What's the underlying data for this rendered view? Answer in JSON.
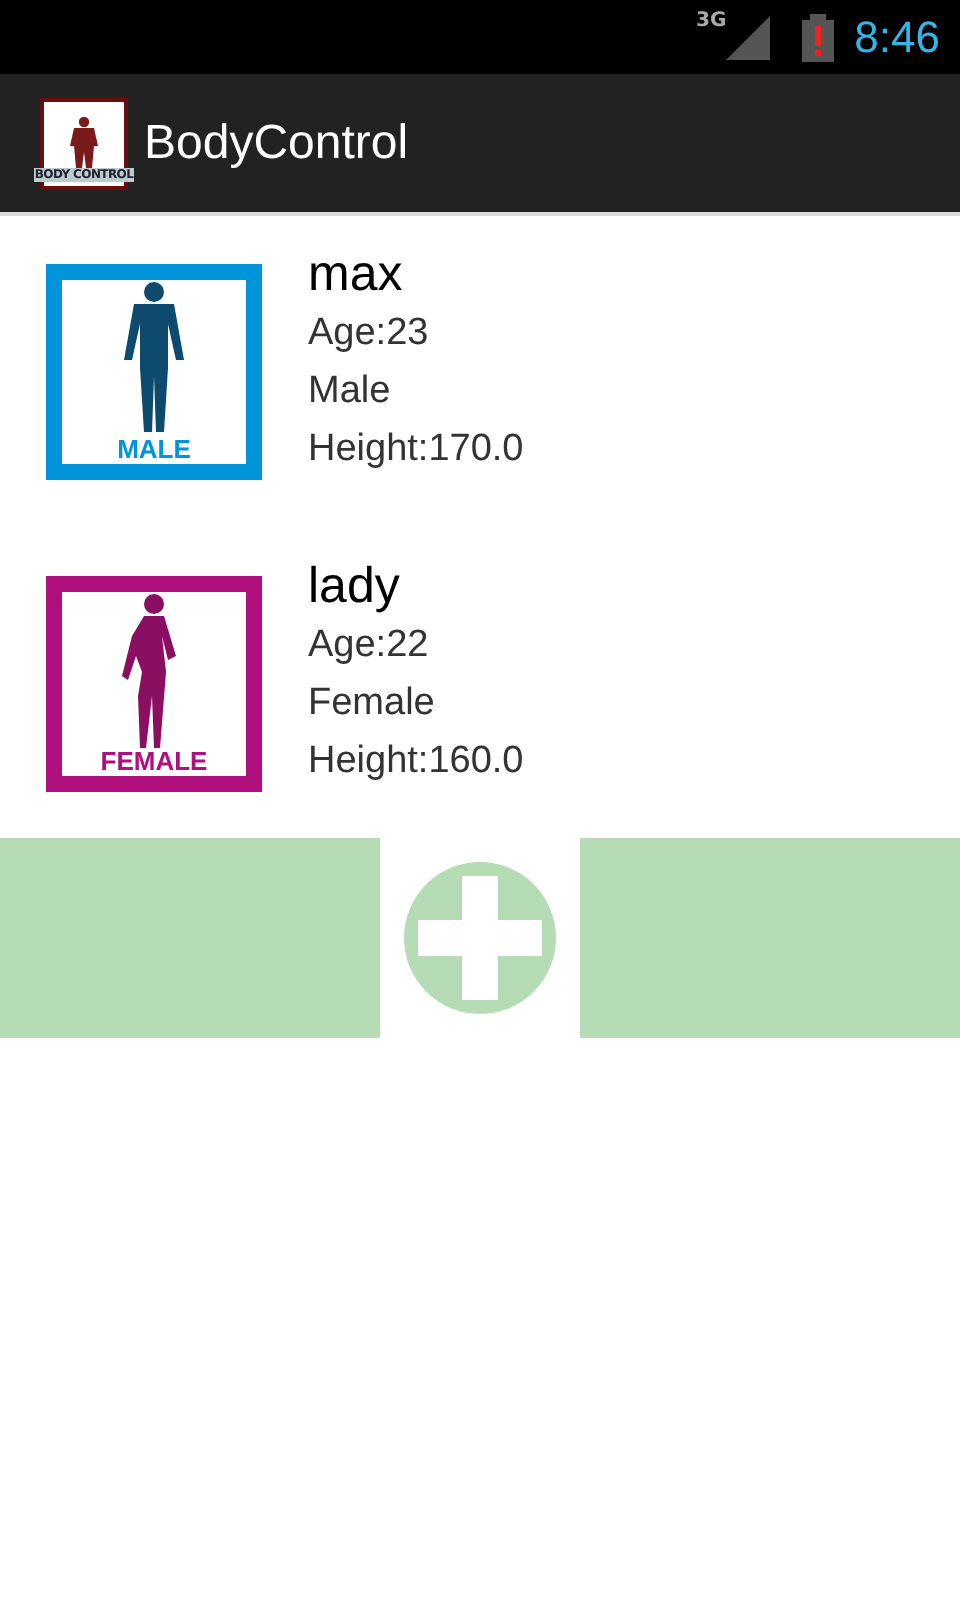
{
  "status_bar": {
    "network": "3G",
    "time": "8:46"
  },
  "action_bar": {
    "logo_text": "BODY CONTROL",
    "title": "BodyControl"
  },
  "people": [
    {
      "name": "max",
      "age": "Age:23",
      "gender": "Male",
      "height": "Height:170.0",
      "badge": "MALE",
      "kind": "male",
      "color": "#0095d9"
    },
    {
      "name": "lady",
      "age": "Age:22",
      "gender": "Female",
      "height": "Height:160.0",
      "badge": "FEMALE",
      "kind": "female",
      "color": "#b0107e"
    }
  ]
}
